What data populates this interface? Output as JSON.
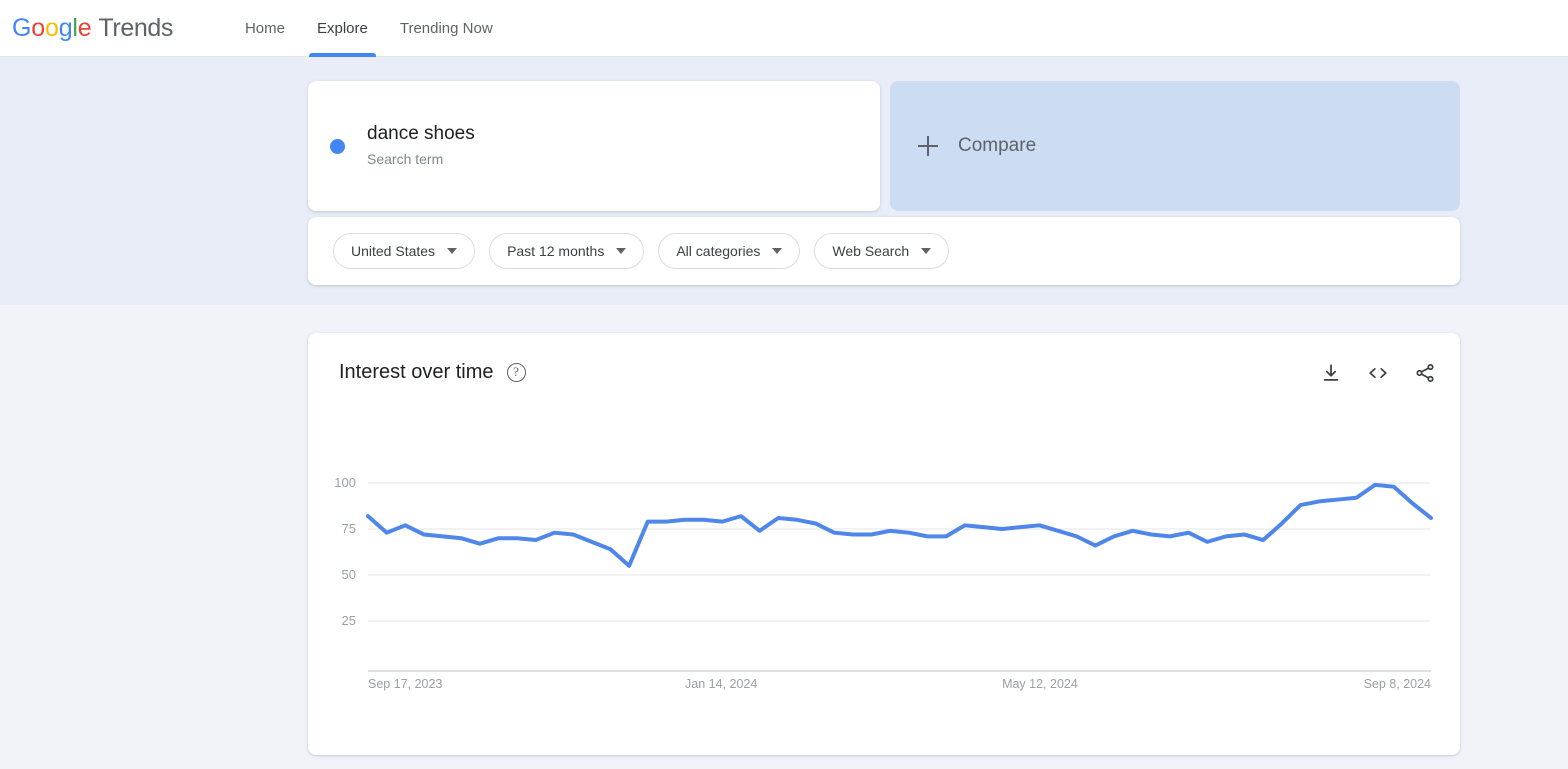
{
  "brand": {
    "logo_letters": [
      {
        "c": "G",
        "color": "#4285f4"
      },
      {
        "c": "o",
        "color": "#ea4335"
      },
      {
        "c": "o",
        "color": "#fbbc05"
      },
      {
        "c": "g",
        "color": "#4285f4"
      },
      {
        "c": "l",
        "color": "#34a853"
      },
      {
        "c": "e",
        "color": "#ea4335"
      }
    ],
    "product": "Trends"
  },
  "nav": {
    "items": [
      {
        "label": "Home",
        "active": false
      },
      {
        "label": "Explore",
        "active": true
      },
      {
        "label": "Trending Now",
        "active": false
      }
    ]
  },
  "query": {
    "term": "dance shoes",
    "term_type": "Search term",
    "term_color": "#4285f4",
    "compare_label": "Compare"
  },
  "filters": [
    {
      "label": "United States"
    },
    {
      "label": "Past 12 months"
    },
    {
      "label": "All categories"
    },
    {
      "label": "Web Search"
    }
  ],
  "chart_card": {
    "title": "Interest over time",
    "help": "?",
    "actions": [
      {
        "name": "download-icon"
      },
      {
        "name": "embed-code-icon"
      },
      {
        "name": "share-icon"
      }
    ]
  },
  "chart_data": {
    "type": "line",
    "title": "Interest over time",
    "xlabel": "",
    "ylabel": "",
    "ylim": [
      0,
      110
    ],
    "yticks": [
      25,
      50,
      75,
      100
    ],
    "ytick_labels": [
      "25",
      "50",
      "75",
      "100"
    ],
    "grid": true,
    "legend": false,
    "line_color": "#4f86ea",
    "line_width": 4,
    "xticks": [
      0,
      17,
      34,
      51
    ],
    "xtick_labels": [
      "Sep 17, 2023",
      "Jan 14, 2024",
      "May 12, 2024",
      "Sep 8, 2024"
    ],
    "series": [
      {
        "name": "dance shoes",
        "values": [
          82,
          73,
          77,
          72,
          71,
          70,
          67,
          70,
          70,
          69,
          73,
          72,
          68,
          64,
          55,
          79,
          79,
          80,
          80,
          79,
          82,
          74,
          81,
          80,
          78,
          73,
          72,
          72,
          74,
          73,
          71,
          71,
          77,
          76,
          75,
          76,
          77,
          74,
          71,
          66,
          71,
          74,
          72,
          71,
          73,
          68,
          71,
          72,
          69,
          78,
          88,
          90,
          91,
          92,
          99,
          98,
          89,
          81
        ]
      }
    ]
  },
  "corner_artifact": "· · ·"
}
